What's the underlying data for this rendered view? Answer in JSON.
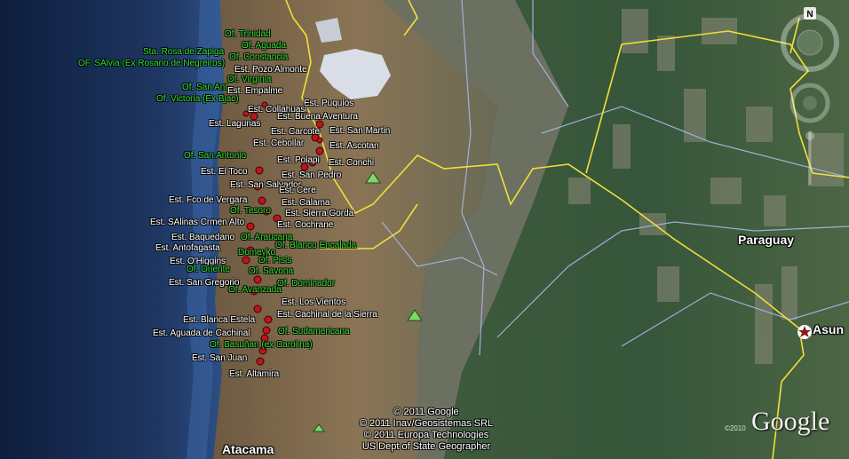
{
  "colors": {
    "border": "#f0e03a",
    "road": "#a8b8e8",
    "station": "#c0141c",
    "mountain": "#7cd86a"
  },
  "places": {
    "atacama": "Atacama",
    "paraguay": "Paraguay",
    "asuncion": "Asun"
  },
  "labels": [
    {
      "t": "Of. Trinidad",
      "c": "g"
    },
    {
      "t": "Of. Aguada",
      "c": "g"
    },
    {
      "t": "Sta. Rosa de Zapiga",
      "c": "g"
    },
    {
      "t": "Of. Constancia",
      "c": "g"
    },
    {
      "t": "OF. SAlvia (Ex Rosario de Negreiros)",
      "c": "g"
    },
    {
      "t": "Est. Pozo Almonte",
      "c": "w"
    },
    {
      "t": "Of. Virginia",
      "c": "g"
    },
    {
      "t": "Of. San Ant",
      "c": "g"
    },
    {
      "t": "Est. Empalme",
      "c": "w"
    },
    {
      "t": "Of. Victoria (Ex Bjac)",
      "c": "g"
    },
    {
      "t": "Est. Puquios",
      "c": "w"
    },
    {
      "t": "Est. Collahuasi",
      "c": "w"
    },
    {
      "t": "Est. Buena Aventura",
      "c": "w"
    },
    {
      "t": "Est. Lagunas",
      "c": "w"
    },
    {
      "t": "Est. Carcote",
      "c": "w"
    },
    {
      "t": "Est. San Martin",
      "c": "w"
    },
    {
      "t": "Est. Cebollar",
      "c": "w"
    },
    {
      "t": "Est. Ascotan",
      "c": "w"
    },
    {
      "t": "Of. San Antonio",
      "c": "g"
    },
    {
      "t": "Est. Polapi",
      "c": "w"
    },
    {
      "t": "Est. Conchi",
      "c": "w"
    },
    {
      "t": "Est. El Toco",
      "c": "w"
    },
    {
      "t": "Est. San Pedro",
      "c": "w"
    },
    {
      "t": "Est. San Salvador",
      "c": "w"
    },
    {
      "t": "Est. Cere",
      "c": "w"
    },
    {
      "t": "Est. Fco de Vergara",
      "c": "w"
    },
    {
      "t": "Est. Calama",
      "c": "w"
    },
    {
      "t": "Of. Tesoro",
      "c": "g"
    },
    {
      "t": "Est. Sierra Gorda",
      "c": "w"
    },
    {
      "t": "Est. SAlinas Crmen Alto",
      "c": "w"
    },
    {
      "t": "Est. Cochrane",
      "c": "w"
    },
    {
      "t": "Est. Baquedano",
      "c": "w"
    },
    {
      "t": "Of. Araucana",
      "c": "g"
    },
    {
      "t": "Est. Antofagasta",
      "c": "w"
    },
    {
      "t": "Of. Blanco Encalada",
      "c": "g"
    },
    {
      "t": "Domeyko",
      "c": "g"
    },
    {
      "t": "Est. O'Higgins",
      "c": "w"
    },
    {
      "t": "Of. Pisis",
      "c": "g"
    },
    {
      "t": "Of. Oriente",
      "c": "g"
    },
    {
      "t": "Of. Savona",
      "c": "g"
    },
    {
      "t": "Est. San Gregorio",
      "c": "w"
    },
    {
      "t": "Of. Dominador",
      "c": "g"
    },
    {
      "t": "Of. Avanzada",
      "c": "g"
    },
    {
      "t": "Est. Los Vientos",
      "c": "w"
    },
    {
      "t": "Est. Cachinal de la Sierra",
      "c": "w"
    },
    {
      "t": "Est. Blanca Estela",
      "c": "w"
    },
    {
      "t": "Est. Aguada de Cachinal",
      "c": "w"
    },
    {
      "t": "Of. Sudamericana",
      "c": "g"
    },
    {
      "t": "Of. Basuñan (ex Carolina)",
      "c": "g"
    },
    {
      "t": "Est. San Juan",
      "c": "w"
    },
    {
      "t": "Est. Altamira",
      "c": "w"
    }
  ],
  "credits": [
    "© 2011 Google",
    "© 2011 Inav/Geosistemas SRL",
    "© 2011 Europa Technologies",
    "US Dept of State Geographer"
  ],
  "logo": "Google",
  "logo_year": "©2010",
  "compass": "N"
}
